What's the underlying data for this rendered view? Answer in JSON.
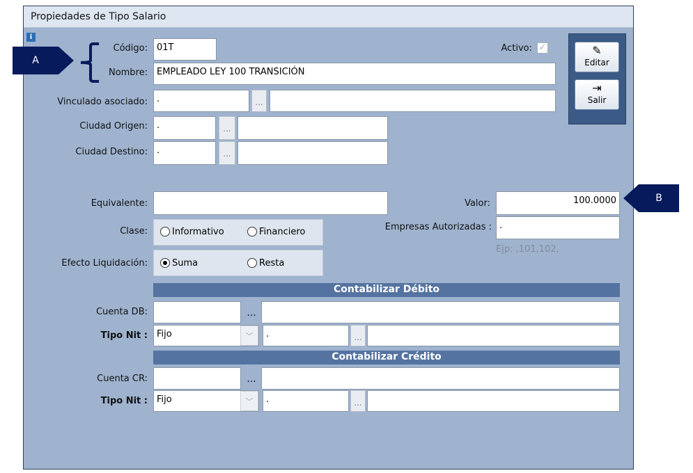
{
  "window": {
    "title": "Propiedades de Tipo Salario"
  },
  "icons": {
    "info": "info-icon",
    "check": "check-icon",
    "edit": "edit-icon",
    "exit": "exit-icon"
  },
  "fields": {
    "codigo": {
      "label": "Código:",
      "value": "01T"
    },
    "activo": {
      "label": "Activo:",
      "checked": true
    },
    "nombre": {
      "label": "Nombre:",
      "value": "EMPLEADO LEY 100 TRANSICIÓN"
    },
    "vinculado": {
      "label": "Vinculado asociado:",
      "value": ".",
      "desc": ""
    },
    "ciudad_origen": {
      "label": "Ciudad Origen:",
      "value": ".",
      "desc": ""
    },
    "ciudad_destino": {
      "label": "Ciudad Destino:",
      "value": ".",
      "desc": ""
    },
    "equivalente": {
      "label": "Equivalente:",
      "value": ""
    },
    "valor": {
      "label": "Valor:",
      "value": "100.0000"
    },
    "empresas": {
      "label": "Empresas Autorizadas :",
      "value": ".",
      "hint": "Ejp: ,101,102,"
    }
  },
  "clase": {
    "label": "Clase:",
    "options": [
      "Informativo",
      "Financiero"
    ],
    "selected": ""
  },
  "efecto": {
    "label": "Efecto Liquidación:",
    "options": [
      "Suma",
      "Resta"
    ],
    "selected": "Suma"
  },
  "debito": {
    "header": "Contabilizar Débito",
    "cuenta_label": "Cuenta DB:",
    "cuenta_value": "",
    "cuenta_desc": "",
    "tiponit_label": "Tipo Nit :",
    "tiponit_value": "Fijo",
    "nit_value": ".",
    "nit_desc": ""
  },
  "credito": {
    "header": "Contabilizar Crédito",
    "cuenta_label": "Cuenta CR:",
    "cuenta_value": "",
    "cuenta_desc": "",
    "tiponit_label": "Tipo Nit :",
    "tiponit_value": "Fijo",
    "nit_value": ".",
    "nit_desc": ""
  },
  "buttons": {
    "editar": "Editar",
    "salir": "Salir",
    "lookup": "..."
  },
  "callouts": {
    "a": "A",
    "b": "B"
  }
}
